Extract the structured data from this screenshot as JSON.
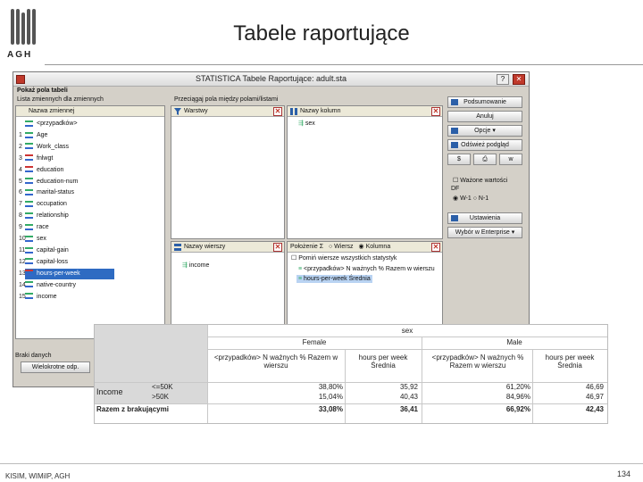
{
  "slide": {
    "title": "Tabele raportujące",
    "logo_text": "AGH",
    "footer_left": "KISIM, WIMiIP, AGH",
    "page_number": "134"
  },
  "window": {
    "title": "STATISTICA Tabele Raportujące: adult.sta",
    "close_glyph": "✕",
    "help_glyph": "?",
    "show_fields_label": "Pokaż pola tabeli",
    "variables_list_label": "Lista zmiennych dla zmiennych",
    "variables_header": "Nazwa zmiennej",
    "variables": [
      {
        "num": "",
        "name": "<przypadków>",
        "selected": false,
        "color": "green"
      },
      {
        "num": "1",
        "name": "Age",
        "selected": false,
        "color": "green"
      },
      {
        "num": "2",
        "name": "Work_class",
        "selected": false,
        "color": "green"
      },
      {
        "num": "3",
        "name": "fnlwgt",
        "selected": false,
        "color": "red"
      },
      {
        "num": "4",
        "name": "education",
        "selected": false,
        "color": "red"
      },
      {
        "num": "5",
        "name": "education-num",
        "selected": false,
        "color": "green"
      },
      {
        "num": "6",
        "name": "marital-status",
        "selected": false,
        "color": "green"
      },
      {
        "num": "7",
        "name": "occupation",
        "selected": false,
        "color": "green"
      },
      {
        "num": "8",
        "name": "relationship",
        "selected": false,
        "color": "green"
      },
      {
        "num": "9",
        "name": "race",
        "selected": false,
        "color": "green"
      },
      {
        "num": "10",
        "name": "sex",
        "selected": false,
        "color": "green"
      },
      {
        "num": "11",
        "name": "capital-gain",
        "selected": false,
        "color": "green"
      },
      {
        "num": "12",
        "name": "capital-loss",
        "selected": false,
        "color": "green"
      },
      {
        "num": "13",
        "name": "hours-per-week",
        "selected": true,
        "color": "red"
      },
      {
        "num": "14",
        "name": "native-country",
        "selected": false,
        "color": "green"
      },
      {
        "num": "15",
        "name": "income",
        "selected": false,
        "color": "green"
      }
    ],
    "fields_area_label": "Przeciągaj pola między polami/listami",
    "layers_label": "Warstwy",
    "column_names_label": "Nazwy kolumn",
    "column_item": "sex",
    "row_names_label": "Nazwy wierszy",
    "row_item": "income",
    "position_label": "Położenie Σ",
    "position_opt_rows": "Wiersz",
    "position_opt_cols": "Kolumna",
    "show_all_stats_label": "Pomiń wiersze wszystkich statystyk",
    "stats_items": [
      {
        "text": "<przypadków> N ważnych % Razem w wierszu",
        "selected": false
      },
      {
        "text": "hours-per-week Średnia",
        "selected": true
      }
    ],
    "missing_label": "Braki danych",
    "multi_resp_button": "Wielokrotne odp.",
    "buttons": {
      "summary": "Podsumowanie",
      "cancel": "Anuluj",
      "options": "Opcje",
      "update": "Odśwież podgląd",
      "weights_label": "Ważone wartości",
      "df_label": "DF",
      "df_opt1": "W-1",
      "df_opt2": "N-1",
      "layouts": "Ustawienia",
      "wizard": "Wybór w Enterprise"
    }
  },
  "result": {
    "group_header": "sex",
    "groups": [
      "Female",
      "Male"
    ],
    "col_headers": [
      "<przypadków> N ważnych % Razem w wierszu",
      "hours per week Średnia",
      "<przypadków> N ważnych % Razem w wierszu",
      "hours per week Średnia"
    ],
    "row_var": "Income",
    "rows": [
      {
        "label": "<=50K",
        "values": [
          "38,80%",
          "35,92",
          "61,20%",
          "46,69"
        ]
      },
      {
        "label": ">50K",
        "values": [
          "15,04%",
          "40,43",
          "84,96%",
          "46,97"
        ]
      }
    ],
    "total_row": {
      "label": "Razem z brakującymi",
      "values": [
        "33,08%",
        "36,41",
        "66,92%",
        "42,43"
      ]
    }
  }
}
